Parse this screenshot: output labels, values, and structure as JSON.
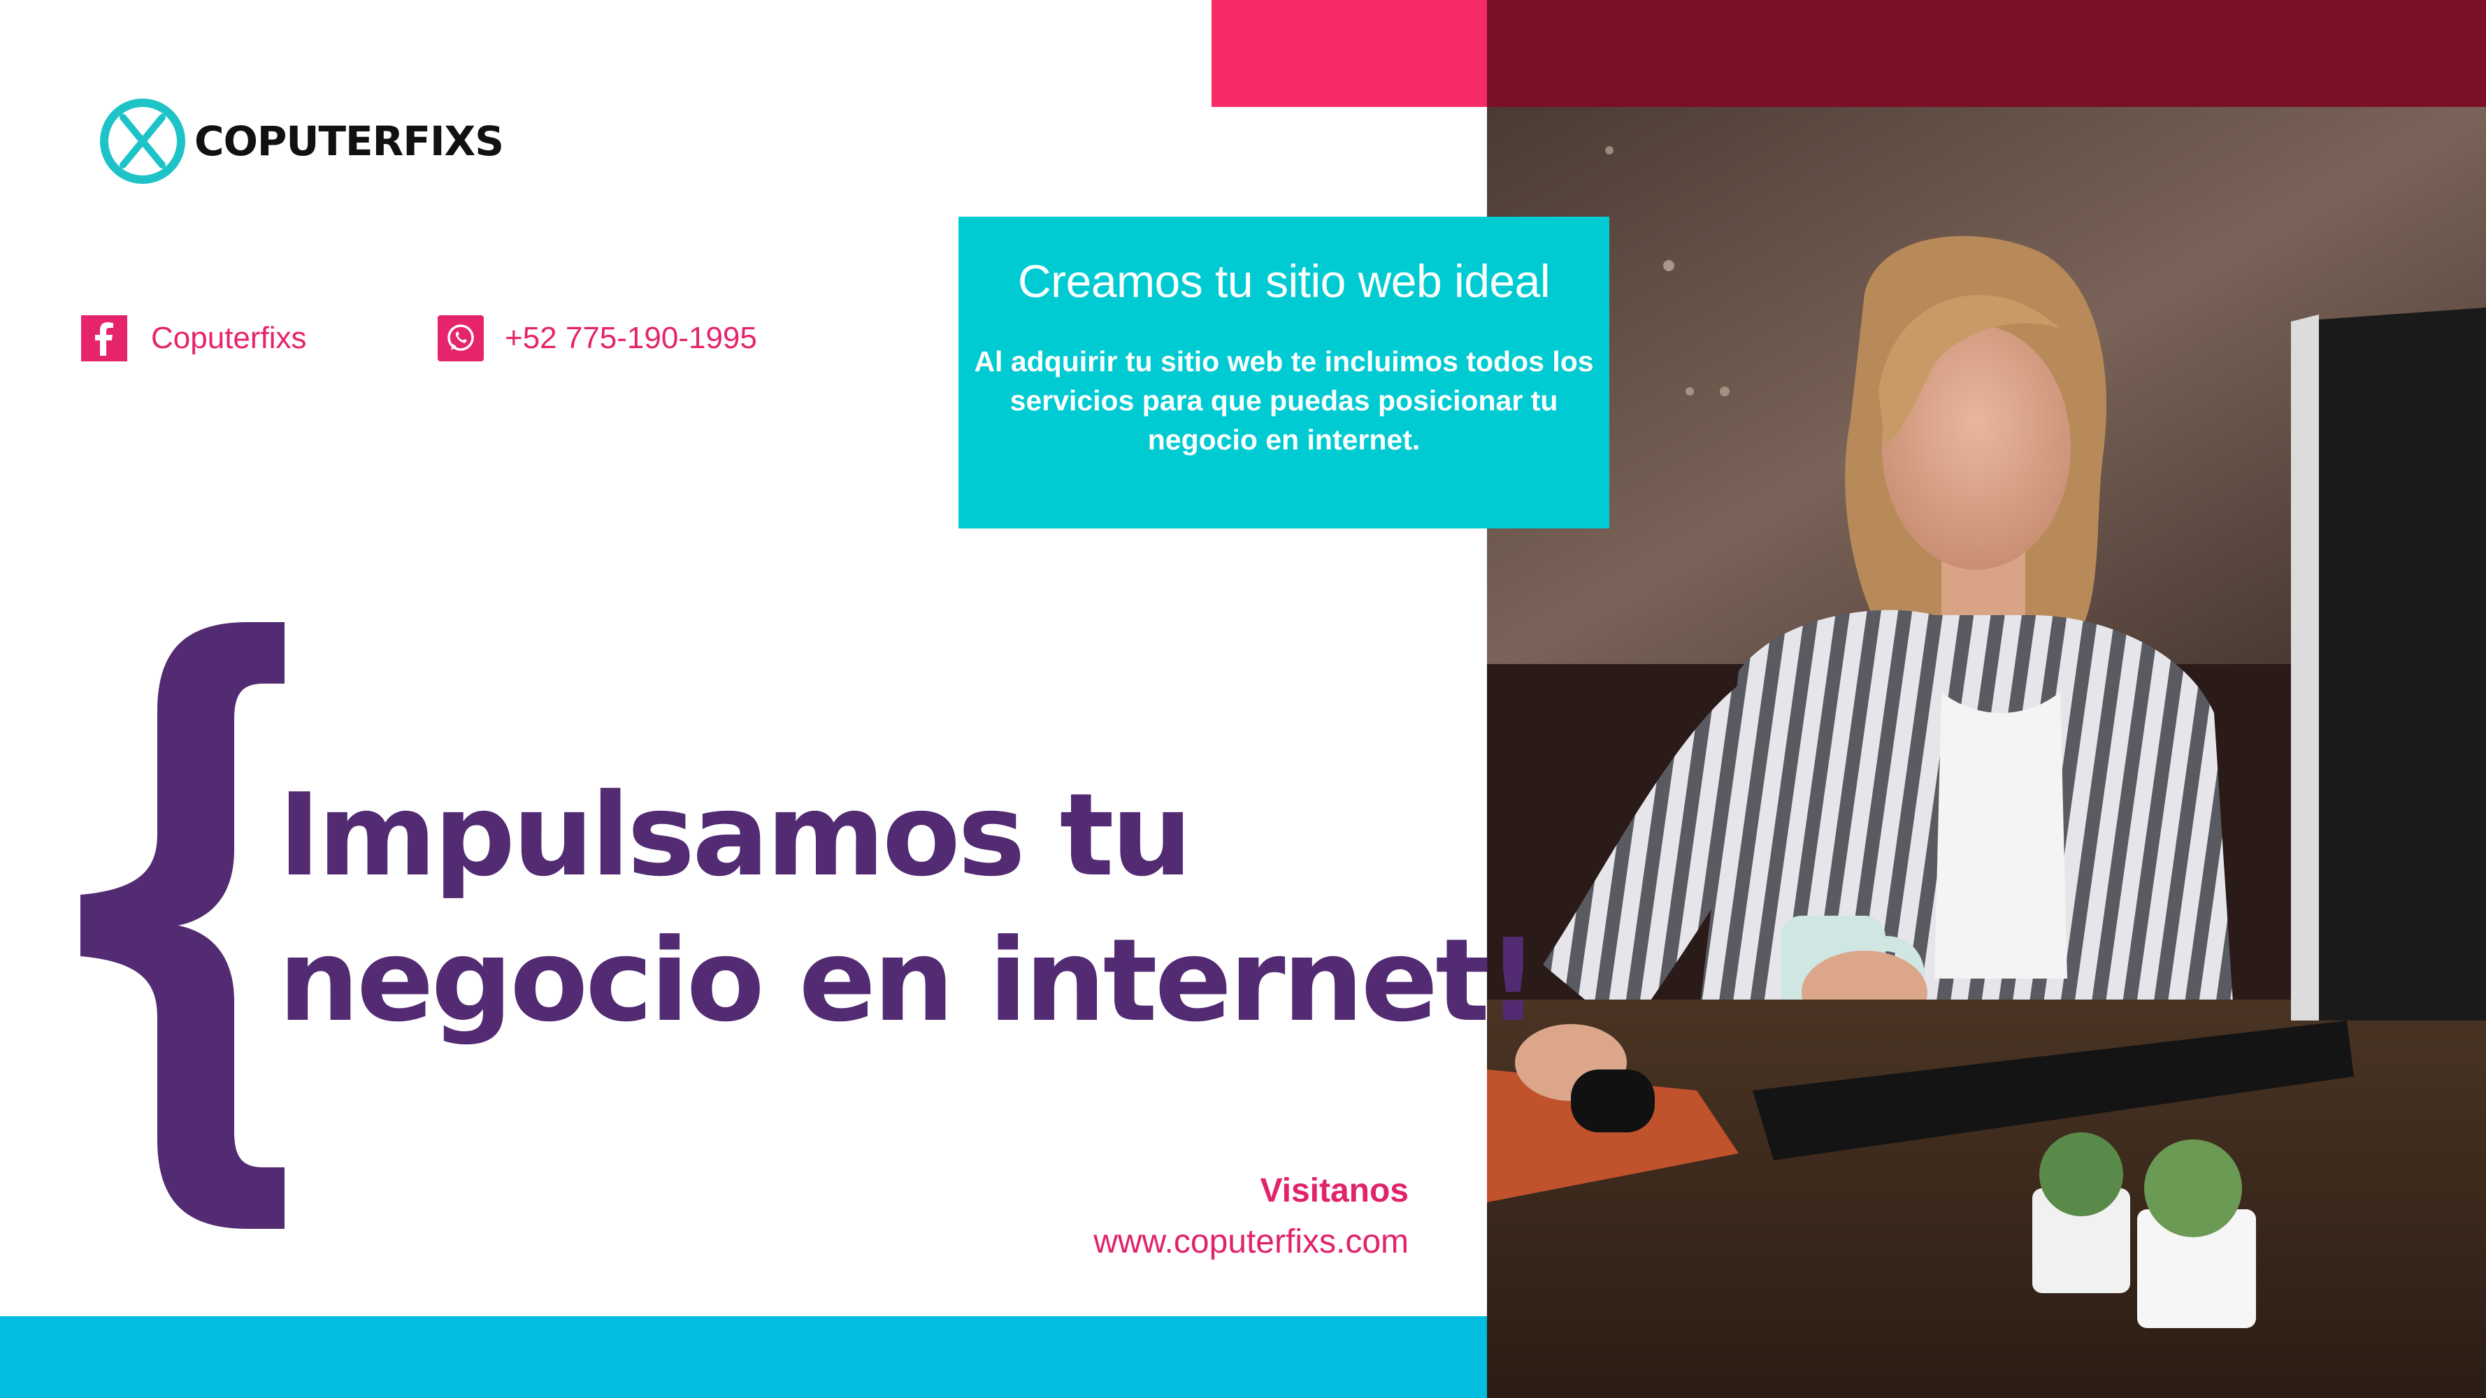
{
  "brand": {
    "name": "COPUTERFIXS",
    "logo_icon": "circle-x-logo-icon"
  },
  "contacts": {
    "facebook": {
      "icon": "facebook-icon",
      "label": "Coputerfixs"
    },
    "whatsapp": {
      "icon": "whatsapp-icon",
      "label": "+52 775-190-1995"
    }
  },
  "info_box": {
    "title": "Creamos tu sitio web ideal",
    "body": "Al adquirir tu sitio web te incluimos todos los servicios para que puedas posicionar tu negocio en internet."
  },
  "headline": {
    "line1": "Impulsamos tu",
    "line2": "negocio en internet!"
  },
  "visit": {
    "label": "Visitanos",
    "url": "www.coputerfixs.com"
  },
  "colors": {
    "purple": "#522b72",
    "pink": "#f52a67",
    "cyan_box": "#00cbd2",
    "cyan_bar": "#02bde0",
    "text_pink": "#e5246c"
  }
}
